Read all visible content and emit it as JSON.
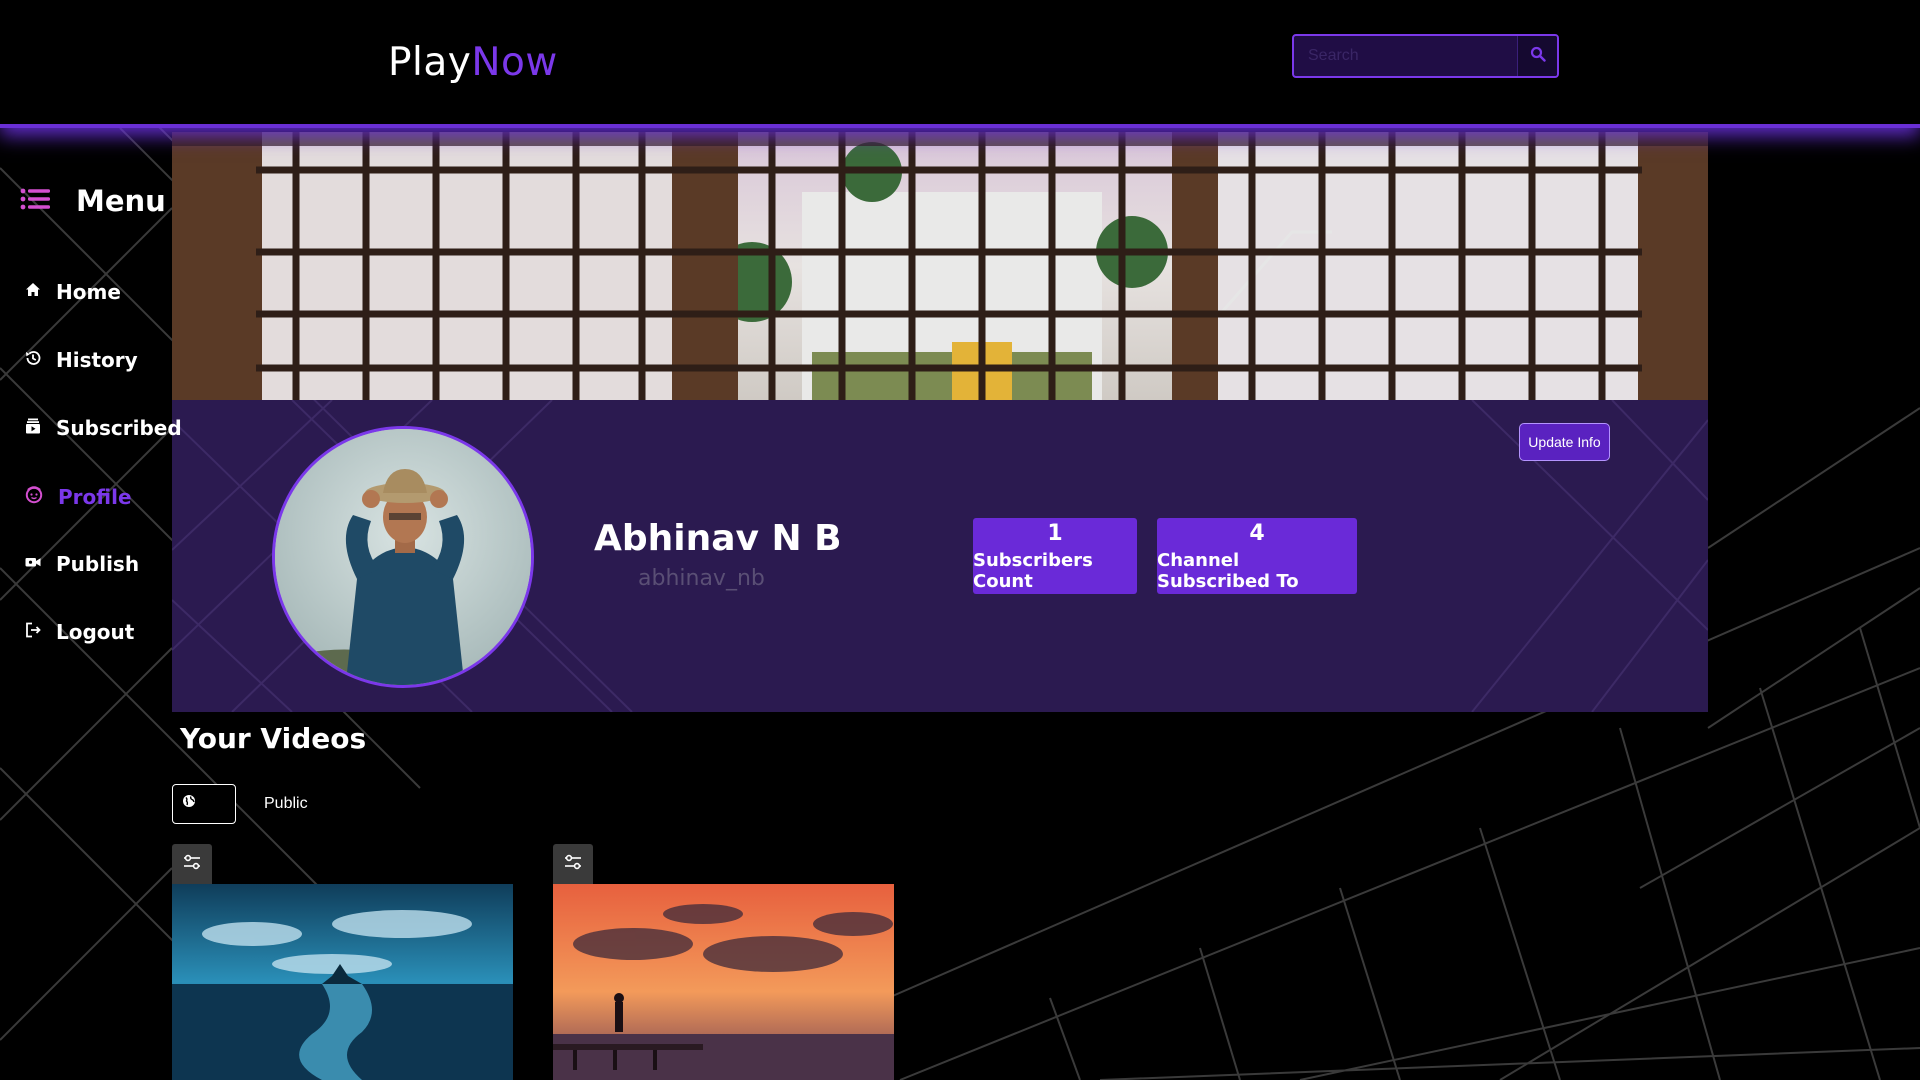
{
  "header": {
    "logo_play": "Play",
    "logo_now": "Now",
    "search_placeholder": "Search",
    "search_icon": "search-icon"
  },
  "sidebar": {
    "menu_label": "Menu",
    "menu_icon": "list-icon",
    "items": [
      {
        "label": "Home",
        "icon": "home-icon",
        "active": false
      },
      {
        "label": "History",
        "icon": "history-icon",
        "active": false
      },
      {
        "label": "Subscribed",
        "icon": "subscriptions-icon",
        "active": false
      },
      {
        "label": "Profile",
        "icon": "profile-face-icon",
        "active": true
      },
      {
        "label": "Publish",
        "icon": "video-camera-icon",
        "active": false
      },
      {
        "label": "Logout",
        "icon": "logout-icon",
        "active": false
      }
    ]
  },
  "profile": {
    "name": "Abhinav N B",
    "handle": "abhinav_nb",
    "update_label": "Update Info",
    "stats": [
      {
        "value": "1",
        "label": "Subscribers Count"
      },
      {
        "value": "4",
        "label": "Channel Subscribed To"
      }
    ]
  },
  "videos": {
    "title": "Your Videos",
    "filter_label": "Public",
    "filter_icon": "globe-icon",
    "edit_icon": "sliders-icon"
  },
  "colors": {
    "accent": "#7b38ea",
    "card_bg": "#2b1a50",
    "stat_bg": "#6a2ad8"
  }
}
